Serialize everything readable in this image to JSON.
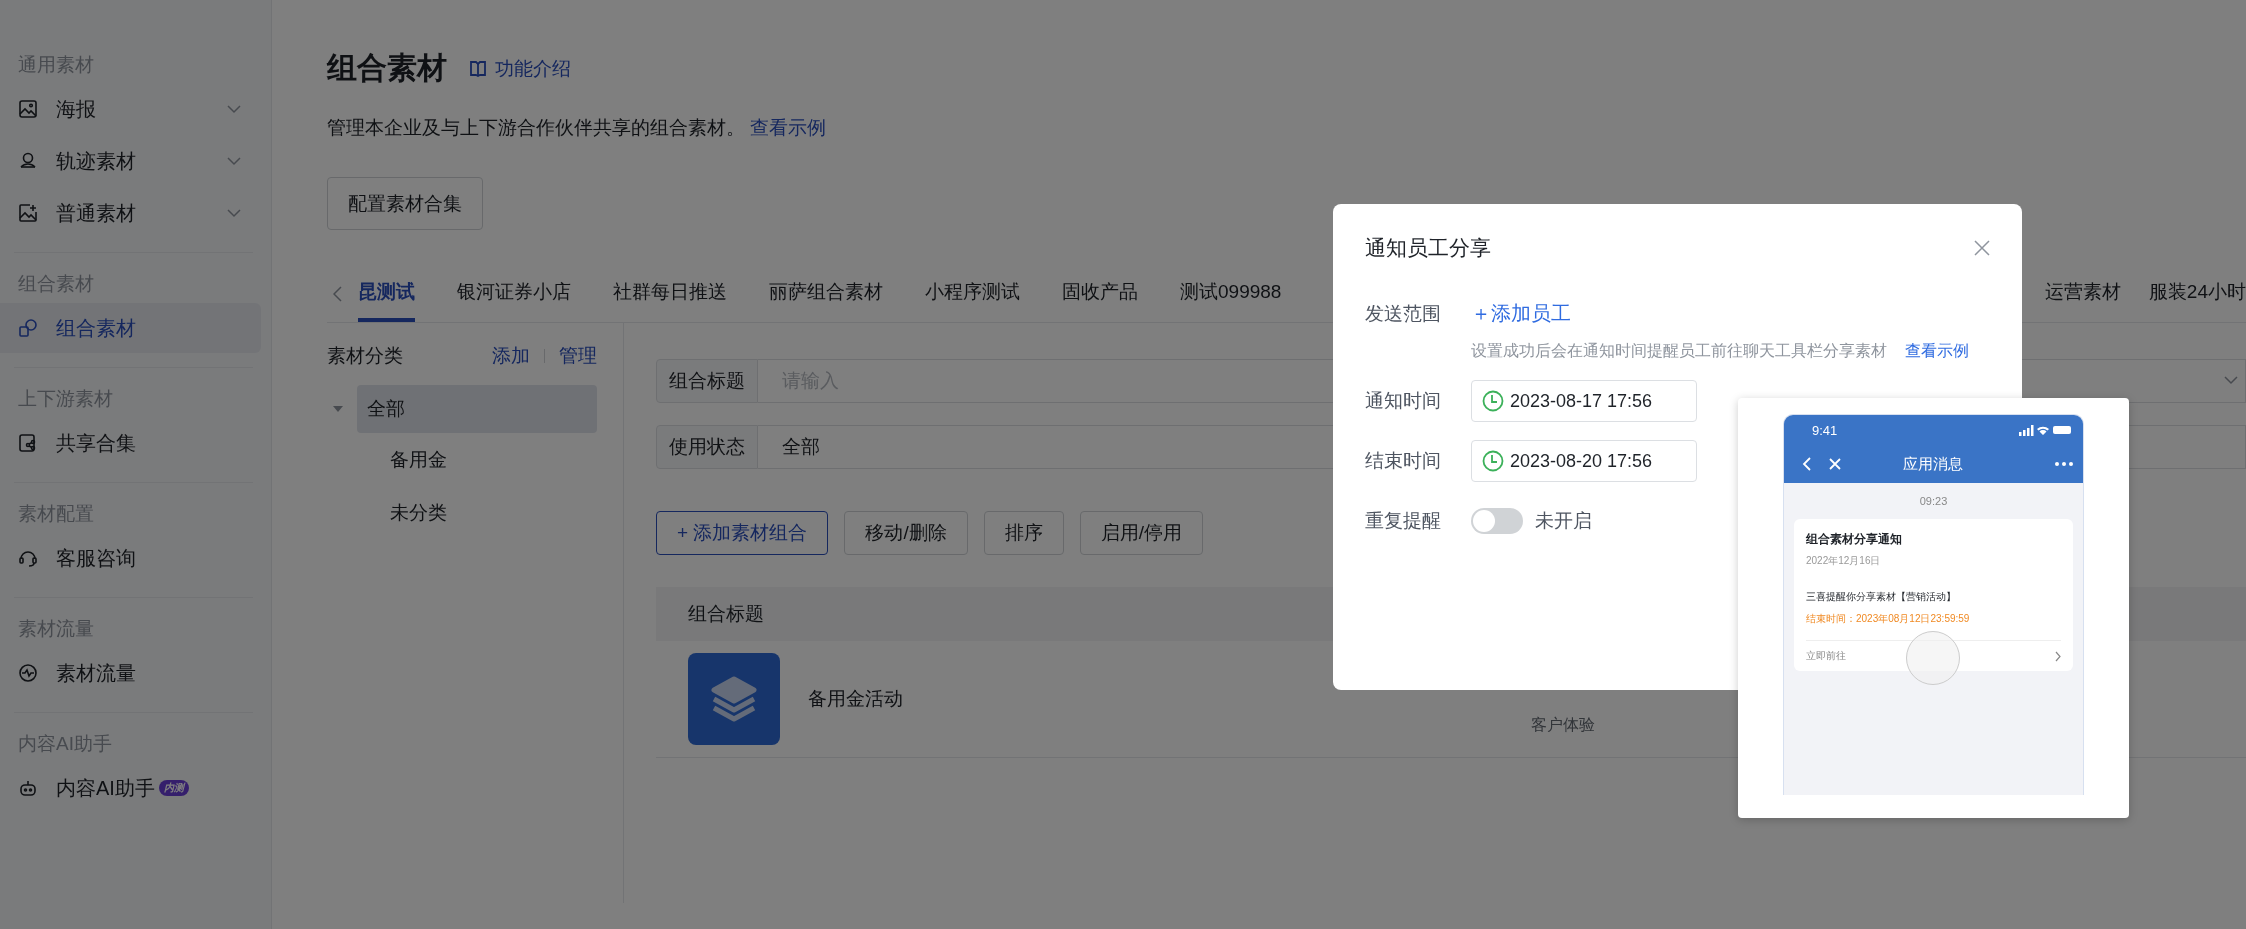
{
  "sidebar": {
    "sections": [
      {
        "heading": "通用素材",
        "items": [
          {
            "label": "海报",
            "kind": "group",
            "selected": false
          },
          {
            "label": "轨迹素材",
            "kind": "group",
            "selected": false
          },
          {
            "label": "普通素材",
            "kind": "group",
            "selected": false
          }
        ]
      },
      {
        "heading": "组合素材",
        "items": [
          {
            "label": "组合素材",
            "kind": "link",
            "selected": true
          }
        ]
      },
      {
        "heading": "上下游素材",
        "items": [
          {
            "label": "共享合集",
            "kind": "link",
            "selected": false
          }
        ]
      },
      {
        "heading": "素材配置",
        "items": [
          {
            "label": "客服咨询",
            "kind": "link",
            "selected": false
          }
        ]
      },
      {
        "heading": "素材流量",
        "items": [
          {
            "label": "素材流量",
            "kind": "link",
            "selected": false
          }
        ]
      },
      {
        "heading": "内容AI助手",
        "items": [
          {
            "label": "内容AI助手",
            "kind": "link",
            "selected": false,
            "badge": "内测"
          }
        ]
      }
    ]
  },
  "header": {
    "title": "组合素材",
    "intro_link": "功能介绍",
    "description": "管理本企业及与上下游合作伙伴共享的组合素材。",
    "example_link": "查看示例"
  },
  "config_button": "配置素材合集",
  "tabs": [
    {
      "label": "昆测试",
      "selected": true
    },
    {
      "label": "银河证券小店",
      "selected": false
    },
    {
      "label": "社群每日推送",
      "selected": false
    },
    {
      "label": "丽萨组合素材",
      "selected": false
    },
    {
      "label": "小程序测试",
      "selected": false
    },
    {
      "label": "固收产品",
      "selected": false
    },
    {
      "label": "测试099988",
      "selected": false
    },
    {
      "label": "运营素材",
      "selected": false
    },
    {
      "label": "服装24小时",
      "selected": false
    }
  ],
  "categories": {
    "title": "素材分类",
    "add_link": "添加",
    "manage_link": "管理",
    "tree": [
      {
        "label": "全部",
        "selected": true,
        "expanded": true,
        "children": [
          {
            "label": "备用金",
            "selected": false
          },
          {
            "label": "未分类",
            "selected": false
          }
        ]
      }
    ]
  },
  "filters": [
    {
      "label": "组合标题",
      "placeholder": "请输入"
    },
    {
      "label": "使用状态",
      "value": "全部"
    }
  ],
  "actions": [
    {
      "label": "+ 添加素材组合",
      "kind": "primary"
    },
    {
      "label": "移动/删除",
      "kind": "default"
    },
    {
      "label": "排序",
      "kind": "default"
    },
    {
      "label": "启用/停用",
      "kind": "default"
    }
  ],
  "table": {
    "columns": [
      "组合标题"
    ],
    "rows": [
      {
        "title": "备用金活动",
        "column_2_subtext": "客户体验"
      }
    ]
  },
  "dialog": {
    "title": "通知员工分享",
    "scope_label": "发送范围",
    "add_staff": "＋添加员工",
    "hint": "设置成功后会在通知时间提醒员工前往聊天工具栏分享素材",
    "hint_link": "查看示例",
    "times": [
      {
        "label": "通知时间",
        "value": "2023-08-17 17:56"
      },
      {
        "label": "结束时间",
        "value": "2023-08-20 17:56"
      }
    ],
    "repeat": {
      "label": "重复提醒",
      "on": false,
      "state_text": "未开启"
    }
  },
  "preview": {
    "status_time": "9:41",
    "nav_title": "应用消息",
    "message_time": "09:23",
    "card": {
      "title": "组合素材分享通知",
      "date": "2022年12月16日",
      "message": "三喜提醒你分享素材【营销活动】",
      "deadline": "结束时间：2023年08月12日23:59:59",
      "action": "立即前往"
    }
  }
}
